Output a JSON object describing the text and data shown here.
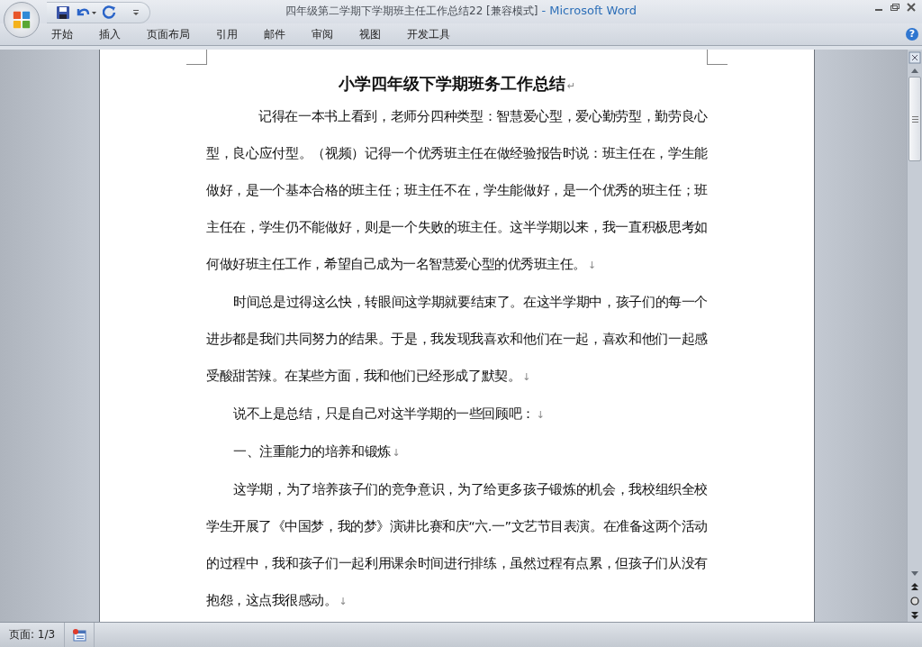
{
  "window": {
    "title": "四年级第二学期下学期班主任工作总结22 [兼容模式]",
    "app_name": "- Microsoft Word"
  },
  "ribbon": {
    "tabs": [
      {
        "label": "开始",
        "selected": false
      },
      {
        "label": "插入",
        "selected": false
      },
      {
        "label": "页面布局",
        "selected": false
      },
      {
        "label": "引用",
        "selected": false
      },
      {
        "label": "邮件",
        "selected": false
      },
      {
        "label": "审阅",
        "selected": false
      },
      {
        "label": "视图",
        "selected": false
      },
      {
        "label": "开发工具",
        "selected": false
      }
    ],
    "help": "?"
  },
  "document": {
    "title": "小学四年级下学期班务工作总结",
    "title_mark": "↵",
    "paragraphs": [
      {
        "kind": "lead",
        "text": "记得在一本书上看到，老师分四种类型：智慧爱心型，爱心勤劳型，勤劳良心型，良心应付型。（视频）记得一个优秀班主任在做经验报告时说：班主任在，学生能做好，是一个基本合格的班主任；班主任不在，学生能做好，是一个优秀的班主任；班主任在，学生仍不能做好，则是一个失败的班主任。这半学期以来，我一直积极思考如何做好班主任工作，希望自己成为一名智慧爱心型的优秀班主任。",
        "mark": "↓"
      },
      {
        "kind": "body",
        "text": "时间总是过得这么快，转眼间这学期就要结束了。在这半学期中，孩子们的每一个进步都是我们共同努力的结果。于是，我发现我喜欢和他们在一起，喜欢和他们一起感受酸甜苦辣。在某些方面，我和他们已经形成了默契。",
        "mark": "↓"
      },
      {
        "kind": "body",
        "text": "说不上是总结，只是自己对这半学期的一些回顾吧：",
        "mark": "↓"
      },
      {
        "kind": "body",
        "text": "一、注重能力的培养和锻炼",
        "mark": "↓"
      },
      {
        "kind": "body",
        "text": "这学期，为了培养孩子们的竞争意识，为了给更多孩子锻炼的机会，我校组织全校学生开展了《中国梦，我的梦》演讲比赛和庆“六.一”文艺节目表演。在准备这两个活动的过程中，我和孩子们一起利用课余时间进行排练，虽然过程有点累，但孩子们从没有抱怨，这点我很感动。",
        "mark": "↓"
      }
    ]
  },
  "status_bar": {
    "page": "页面: 1/3"
  }
}
